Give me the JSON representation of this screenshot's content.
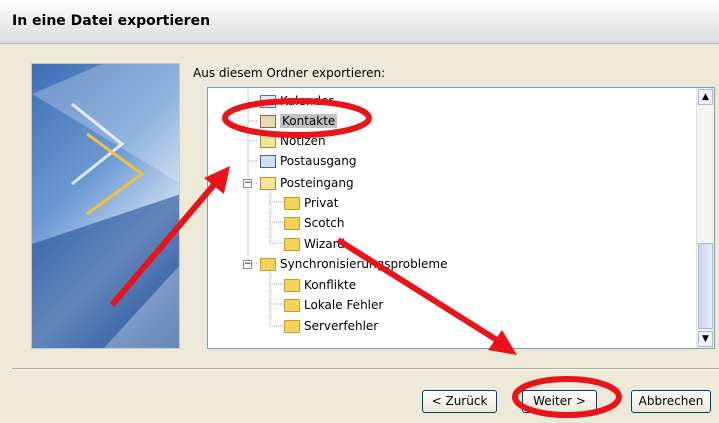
{
  "window": {
    "title": "In eine Datei exportieren"
  },
  "export_label": "Aus diesem Ordner exportieren:",
  "tree": [
    {
      "label": "Kalender",
      "icon": "calendar-folder-icon"
    },
    {
      "label": "Kontakte",
      "icon": "contacts-folder-icon",
      "selected": true
    },
    {
      "label": "Notizen",
      "icon": "notes-folder-icon"
    },
    {
      "label": "Postausgang",
      "icon": "outbox-folder-icon"
    },
    {
      "label": "Posteingang",
      "icon": "inbox-folder-icon",
      "expanded": true
    },
    {
      "label": "Privat",
      "icon": "folder-icon"
    },
    {
      "label": "Scotch",
      "icon": "folder-icon"
    },
    {
      "label": "Wizard",
      "icon": "folder-icon"
    },
    {
      "label": "Synchronisierungsprobleme",
      "icon": "folder-icon",
      "expanded": true
    },
    {
      "label": "Konflikte",
      "icon": "folder-icon"
    },
    {
      "label": "Lokale Fehler",
      "icon": "folder-icon"
    },
    {
      "label": "Serverfehler",
      "icon": "folder-icon"
    }
  ],
  "buttons": {
    "back": "< Zurück",
    "next": "Weiter >",
    "cancel": "Abbrechen"
  },
  "colors": {
    "annotation": "#e8141a",
    "tree_border": "#7f9db9"
  }
}
